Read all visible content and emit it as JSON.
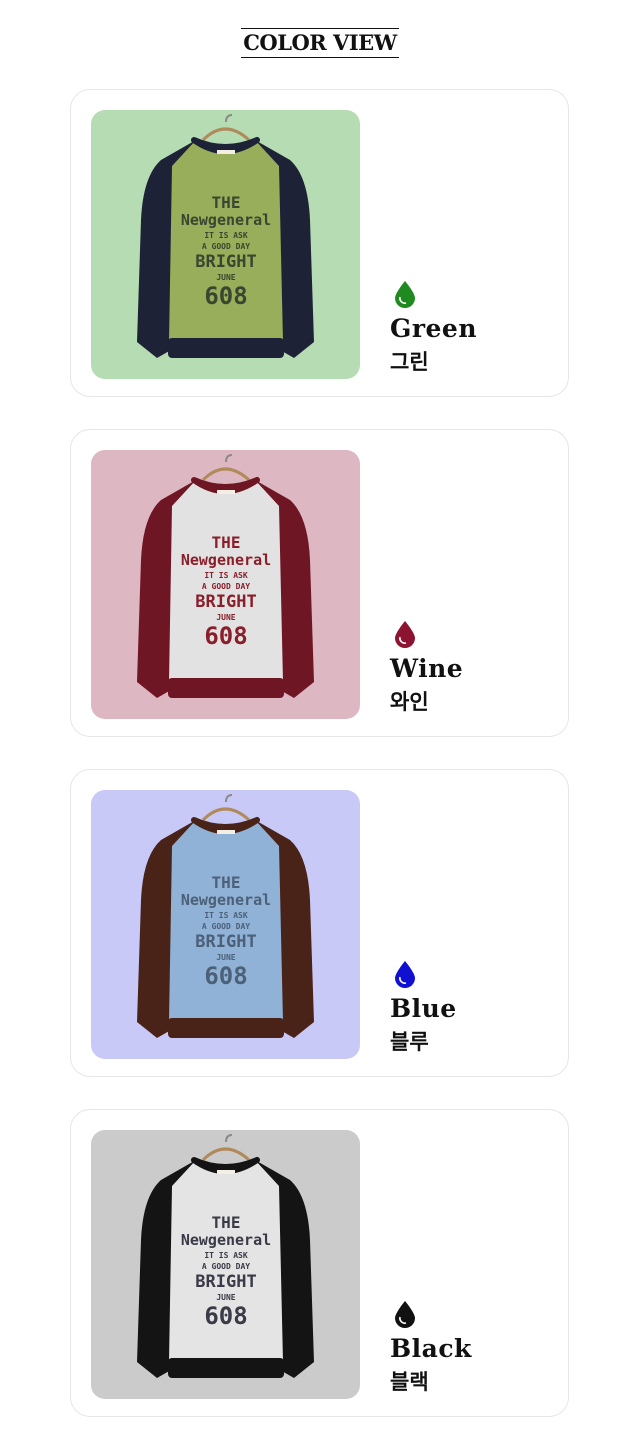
{
  "header": {
    "title": "COLOR VIEW"
  },
  "colors": [
    {
      "name_en": "Green",
      "name_ko": "그린",
      "icon": "water-drop-icon",
      "drop_color": "#1f8a1f",
      "bg_color": "#b5dcb2",
      "body_color": "#98ae5a",
      "sleeve_color": "#1d2236",
      "print_color": "#3b4630",
      "graphic_lines": [
        "THE",
        "Newgeneral",
        "IT IS ASK",
        "A GOOD DAY",
        "BRIGHT",
        "JUNE",
        "608"
      ]
    },
    {
      "name_en": "Wine",
      "name_ko": "와인",
      "icon": "water-drop-icon",
      "drop_color": "#8c1430",
      "bg_color": "#ddb7c2",
      "body_color": "#e2e2e2",
      "sleeve_color": "#6f1625",
      "print_color": "#8a1f2c",
      "graphic_lines": [
        "THE",
        "Newgeneral",
        "IT IS ASK",
        "A GOOD DAY",
        "BRIGHT",
        "JUNE",
        "608"
      ]
    },
    {
      "name_en": "Blue",
      "name_ko": "블루",
      "icon": "water-drop-icon",
      "drop_color": "#1010d0",
      "bg_color": "#c9c9f8",
      "body_color": "#8fb2d6",
      "sleeve_color": "#4a2318",
      "print_color": "#4c6078",
      "graphic_lines": [
        "THE",
        "Newgeneral",
        "IT IS ASK",
        "A GOOD DAY",
        "BRIGHT",
        "JUNE",
        "608"
      ]
    },
    {
      "name_en": "Black",
      "name_ko": "블랙",
      "icon": "water-drop-icon",
      "drop_color": "#111111",
      "bg_color": "#cbcbcb",
      "body_color": "#e4e4e4",
      "sleeve_color": "#141414",
      "print_color": "#3a3a48",
      "graphic_lines": [
        "THE",
        "Newgeneral",
        "IT IS ASK",
        "A GOOD DAY",
        "BRIGHT",
        "JUNE",
        "608"
      ]
    }
  ]
}
